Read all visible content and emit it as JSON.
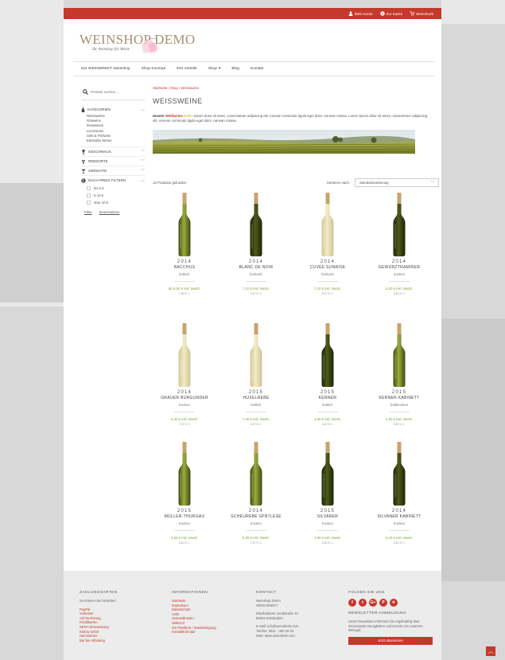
{
  "topbar": {
    "links": [
      {
        "label": "Mein Konto",
        "icon": "user-icon"
      },
      {
        "label": "Zur Kasse",
        "icon": "checkout-icon"
      },
      {
        "label": "Warenkorb",
        "icon": "cart-icon"
      }
    ]
  },
  "logo": {
    "main": "WEINSHOP DEMO",
    "tagline": "Ihr Weinshop für Weine"
  },
  "nav": {
    "items": [
      {
        "label": "Der WEINDIREKT Weinshop"
      },
      {
        "label": "Shop-Konzept"
      },
      {
        "label": "Ihre Vorteile"
      },
      {
        "label": "Shop",
        "dropdown": true
      },
      {
        "label": "Blog"
      },
      {
        "label": "Kontakt"
      }
    ]
  },
  "sidebar": {
    "search_placeholder": "Produkt suchen ...",
    "categories_label": "KATEGORIEN",
    "categories": [
      "Weissweine",
      "Rotweine",
      "Roséweine",
      "Lizenweine",
      "Sekt & Perlwein",
      "Edelsüße Weine"
    ],
    "facets": [
      {
        "label": "GESCHMACK",
        "icon": "glass-icon"
      },
      {
        "label": "REBSORTE",
        "icon": "grape-icon"
      },
      {
        "label": "GERICHTE",
        "icon": "dish-icon"
      }
    ],
    "price_label": "NACH PREIS FILTERN",
    "price_options": [
      "bis 5 €",
      "5-10 €",
      "über 10 €"
    ],
    "filter_label": "Filter",
    "reset_label": "Zurücksetzen"
  },
  "main": {
    "breadcrumb": "Startseite / Shop / Weissweine",
    "title": "WEISSWEINE",
    "intro_bold": "Unsere",
    "intro_red": "Weißweine",
    "intro_yellow": "bieten",
    "intro_rest": " Ipsum dolor sit amet, consectetuer adipiscing elit. Aenean commodo ligula eget dolor. Aenean massa. Lorem ipsum dolor sit amet, consectetuer adipiscing elit. Aenean commodo ligula eget dolor. Aenean massa.",
    "products_found": "13 Produkte gefunden",
    "sort_label": "Sortieren nach:",
    "sort_value": "Standardsortierung"
  },
  "products": [
    {
      "year": "2014",
      "name": "BACCHUS",
      "taste": "lieblich",
      "price": "ab 5,90 € inkl. MwSt.",
      "liter": "7,86 € / L",
      "wine": "green"
    },
    {
      "year": "2014",
      "name": "BLANC DE NOIR",
      "taste": "feinherb",
      "price": "7,10 € inkl. MwSt.",
      "liter": "9,47 € / L",
      "wine": "dark"
    },
    {
      "year": "2014",
      "name": "CUVÉE SUNRISE",
      "taste": "feinherb",
      "price": "7,10 € inkl. MwSt.",
      "liter": "9,47 € / L",
      "wine": "pale"
    },
    {
      "year": "2014",
      "name": "GEWÜRZTRAMINER",
      "taste": "trocken",
      "price": "6,40 € inkl. MwSt.",
      "liter": "8,53 € / L",
      "wine": "dark"
    },
    {
      "year": "2014",
      "name": "GRAUER BURGUNDER",
      "taste": "trocken",
      "price": "5,30 € inkl. MwSt.",
      "liter": "7,07 € / L",
      "wine": "pale"
    },
    {
      "year": "2015",
      "name": "HUXELREBE",
      "taste": "lieblich",
      "price": "7,40 € inkl. MwSt.",
      "liter": "9,87 € / L",
      "wine": "pale"
    },
    {
      "year": "2015",
      "name": "KERNER",
      "taste": "lieblich",
      "price": "4,80 € inkl. MwSt.",
      "liter": "6,40 € / L",
      "wine": "dark"
    },
    {
      "year": "2015",
      "name": "KERNER KABINETT",
      "taste": "halbtrocken",
      "price": "4,80 € inkl. MwSt.",
      "liter": "6,90 € / L",
      "wine": "green"
    },
    {
      "year": "2015",
      "name": "MÜLLER-THURGAU",
      "taste": "trocken",
      "price": "5,60 € inkl. MwSt.",
      "liter": "5,60 € / L",
      "wine": "green"
    },
    {
      "year": "2014",
      "name": "SCHEUREBE SPÄTLESE",
      "taste": "trocken",
      "price": "5,80 € inkl. MwSt.",
      "liter": "7,47 € / L",
      "wine": "green"
    },
    {
      "year": "2015",
      "name": "SILVANER",
      "taste": "trocken",
      "price": "4,90 € inkl. MwSt.",
      "liter": "6,53 € / L",
      "wine": "dark"
    },
    {
      "year": "2014",
      "name": "SILVANER KABINETT",
      "taste": "trocken",
      "price": "6,40 € inkl. MwSt.",
      "liter": "8,53 € / L",
      "wine": "dark"
    }
  ],
  "footer": {
    "payment_head": "ZAHLUNGSARTEN",
    "payment_intro": "So können Sie bezahlen:",
    "payment_links": [
      "PayPal",
      "Vorkasse",
      "Auf Rechnung",
      "Kreditkarten",
      "SEPA-Überweisung",
      "Klarna Sofort",
      "Nachnahme",
      "Bar bei Abholung"
    ],
    "info_head": "INFORMATIONEN",
    "info_links": [
      "Startseite",
      "Impressum",
      "Datenschutz",
      "AGB",
      "Versandkosten",
      "Widerruf",
      "OS-Plattform / Streitbeilegung",
      "Kontaktformular"
    ],
    "contact_head": "KONTAKT",
    "contact_lines_1": [
      "Weinshop Demo",
      "WEIN DIREKT"
    ],
    "contact_lines_2": [
      "Wiesbadener Landstraße 16",
      "65203 Wiesbaden"
    ],
    "contact_email": "E-Mail: info@weindirekt.com",
    "contact_phone": "Telefon: 0611 - 450 33 23",
    "contact_web": "Web: www.weindirekt.com",
    "follow_head": "FOLGEN SIE UNS",
    "social": [
      {
        "glyph": "f",
        "icon": "facebook-icon"
      },
      {
        "glyph": "t",
        "icon": "twitter-icon"
      },
      {
        "glyph": "G+",
        "icon": "googleplus-icon"
      },
      {
        "glyph": "P",
        "icon": "pinterest-icon"
      },
      {
        "glyph": "✈",
        "icon": "telegram-icon"
      }
    ],
    "newsletter_head": "NEWSLETTER-ANMELDUNG",
    "newsletter_text": "Unser Newsletter informiert Sie regelmäßig über interessante Neuigkeiten und Events von unserem Weingut.",
    "subscribe_label": "Jetzt abonnieren"
  },
  "colors": {
    "accent": "#c4392b",
    "price_green": "#7fa63f"
  }
}
